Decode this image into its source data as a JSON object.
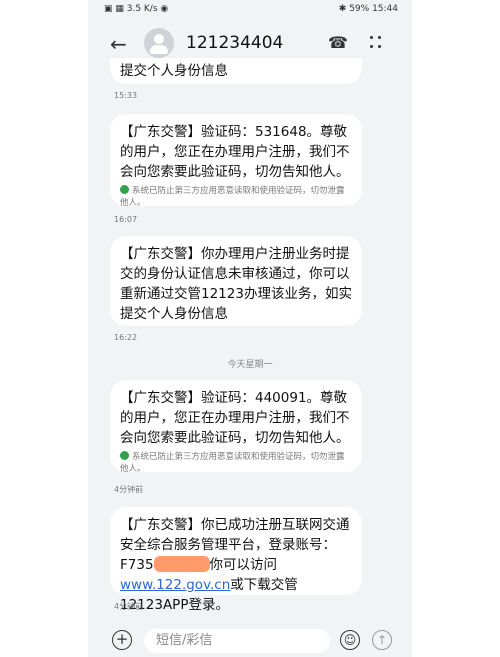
{
  "status": {
    "left": "▣ ▦ 3.5 K/s ◉",
    "right": "✱ 59% 15:44"
  },
  "header": {
    "title": "121234404",
    "back": "←",
    "phone": "☎"
  },
  "messages": [
    {
      "text": "提交个人身份信息",
      "time": "15:33"
    },
    {
      "text": "【广东交警】验证码：531648。尊敬的用户，您正在办理用户注册，我们不会向您索要此验证码，切勿告知他人。",
      "note": "系统已防止第三方应用恶意读取和使用验证码，切勿泄露他人。",
      "time": "16:07"
    },
    {
      "text": "【广东交警】你办理用户注册业务时提交的身份认证信息未审核通过，你可以重新通过交管12123办理该业务，如实提交个人身份信息",
      "time": "16:22"
    },
    {
      "text": "【广东交警】验证码：440091。尊敬的用户，您正在办理用户注册，我们不会向您索要此验证码，切勿告知他人。",
      "note": "系统已防止第三方应用恶意读取和使用验证码，切勿泄露他人。",
      "time": "4分钟前"
    },
    {
      "text_a": "【广东交警】你已成功注册互联网交通安全综合服务管理平台，登录账号：F735",
      "text_b": "你可以访问",
      "link": "www.122.gov.cn",
      "text_c": "或下载交管12123APP登录。",
      "time": "4分钟前"
    }
  ],
  "day_label": "今天星期一",
  "input": {
    "placeholder": "短信/彩信"
  }
}
